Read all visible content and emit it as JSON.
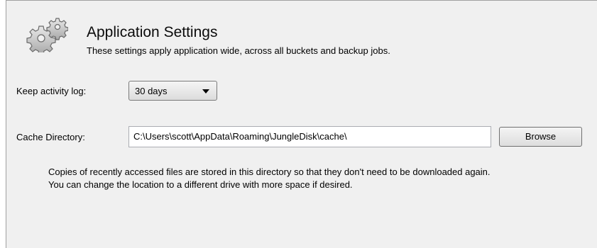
{
  "header": {
    "icon": "gears-icon",
    "title": "Application Settings",
    "subtitle": "These settings apply application wide, across all buckets and backup jobs."
  },
  "activity_log": {
    "label": "Keep activity log:",
    "selected": "30 days"
  },
  "cache": {
    "label": "Cache Directory:",
    "value": "C:\\Users\\scott\\AppData\\Roaming\\JungleDisk\\cache\\",
    "browse_label": "Browse",
    "help": "Copies of recently accessed files are stored in this directory so that they don't need to be downloaded again. You can change the location to a different drive with more space if desired."
  }
}
